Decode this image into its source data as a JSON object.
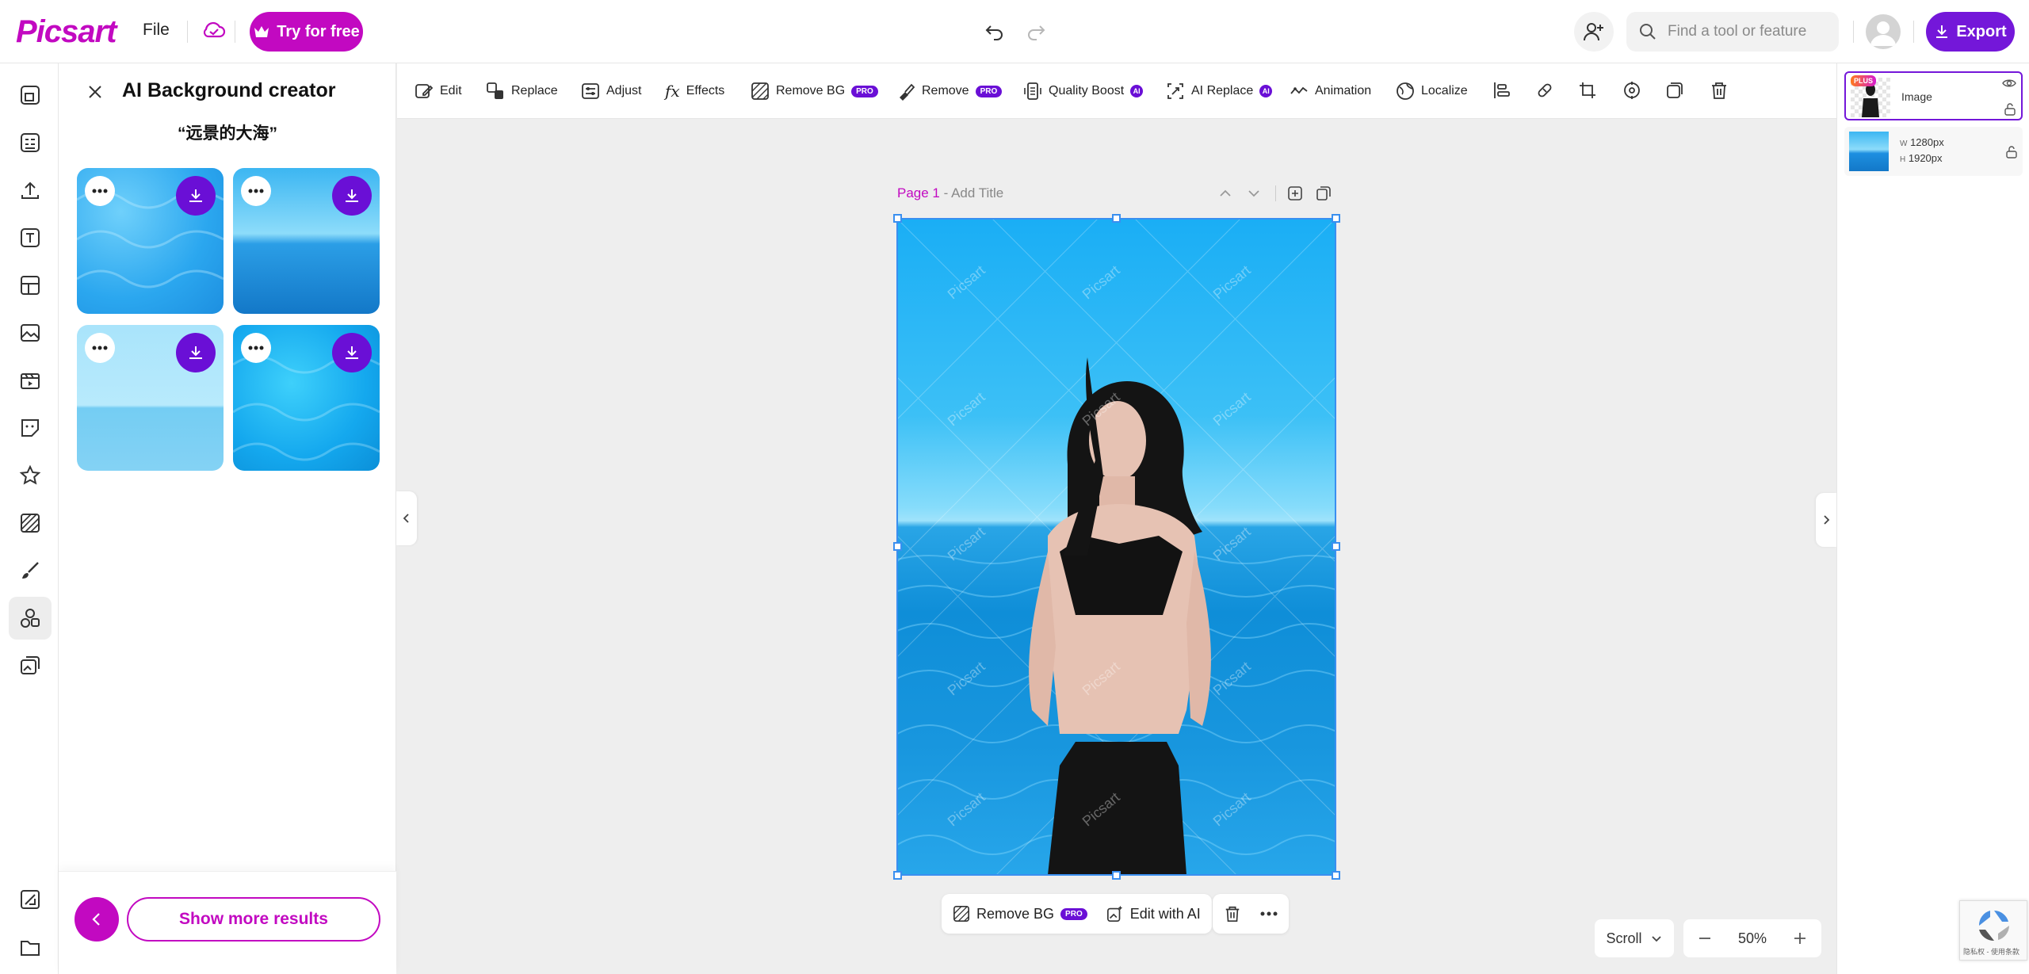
{
  "header": {
    "logo": "Picsart",
    "file_label": "File",
    "try_label": "Try for free",
    "search_placeholder": "Find a tool or feature",
    "export_label": "Export"
  },
  "panel": {
    "title": "AI Background creator",
    "prompt": "“远景的大海”",
    "show_more": "Show more results"
  },
  "toolbar": {
    "edit": "Edit",
    "replace": "Replace",
    "adjust": "Adjust",
    "effects": "Effects",
    "remove_bg": "Remove BG",
    "remove": "Remove",
    "quality_boost": "Quality Boost",
    "ai_replace": "AI Replace",
    "animation": "Animation",
    "localize": "Localize",
    "pro_badge": "PRO",
    "ai_badge": "AI"
  },
  "canvas": {
    "page_label": "Page 1",
    "title_placeholder": "Add Title",
    "watermark": "Picsart"
  },
  "float_bar": {
    "remove_bg": "Remove BG",
    "pro": "PRO",
    "edit_ai": "Edit with AI"
  },
  "bottom": {
    "scroll": "Scroll",
    "zoom": "50%"
  },
  "layers": {
    "image_name": "Image",
    "plus_badge": "PLUS",
    "width_label": "W",
    "width_value": "1280px",
    "height_label": "H",
    "height_value": "1920px"
  },
  "recaptcha_text": "隐私权 - 使用条款",
  "colors": {
    "brand": "#c209c1",
    "export": "#7417d9",
    "download": "#6a0fd6",
    "selection": "#3a8ff0"
  }
}
